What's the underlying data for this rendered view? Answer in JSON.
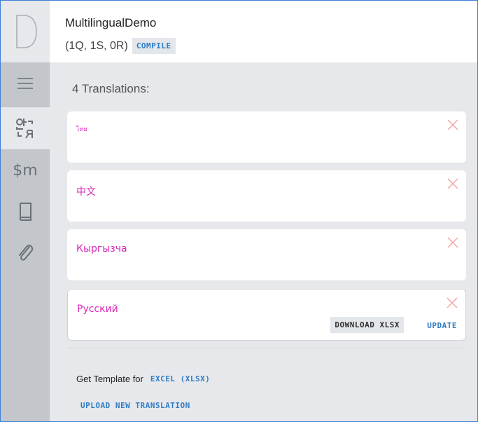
{
  "app": {
    "logo_letter": "D",
    "title": "MultilingualDemo",
    "counts": "(1Q, 1S, 0R)",
    "compile_label": "COMPILE"
  },
  "sidebar": {
    "items": [
      {
        "name": "menu-icon"
      },
      {
        "name": "translation-icon",
        "active": true
      },
      {
        "name": "money-icon",
        "label": "$m"
      },
      {
        "name": "book-icon"
      },
      {
        "name": "paperclip-icon"
      }
    ]
  },
  "translations": {
    "heading": "4 Translations:",
    "items": [
      {
        "lang": "ไทย"
      },
      {
        "lang": "中文"
      },
      {
        "lang": "Кыргызча"
      },
      {
        "lang": "Русский",
        "download_label": "DOWNLOAD XLSX",
        "update_label": "UPDATE"
      }
    ]
  },
  "footer": {
    "template_text": "Get Template for",
    "excel_label": "EXCEL (XLSX)",
    "upload_label": "UPLOAD NEW TRANSLATION"
  },
  "colors": {
    "accent": "#2f7cc6",
    "language": "#d629b6",
    "close": "#f4a6a6"
  }
}
